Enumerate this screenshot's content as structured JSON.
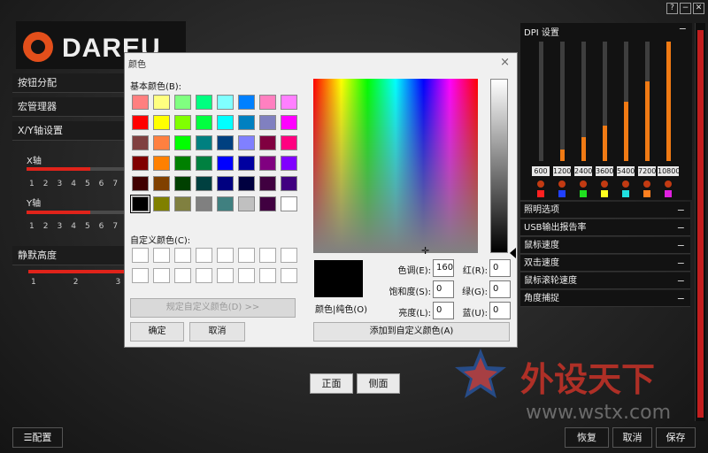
{
  "window_controls": [
    "?",
    "−",
    "✕"
  ],
  "logo": {
    "text": "DAREU"
  },
  "left_panel": {
    "sections": [
      "按钮分配",
      "宏管理器",
      "X/Y轴设置"
    ],
    "x_axis_label": "X轴",
    "y_axis_label": "Y轴",
    "x_value_fraction": 0.63,
    "y_value_fraction": 0.63,
    "axis_ticks": [
      "1",
      "2",
      "3",
      "4",
      "5",
      "6",
      "7"
    ],
    "silent_height_label": "静默高度",
    "silent_ticks": [
      "1",
      "2",
      "3"
    ],
    "silent_value_fraction": 1.0
  },
  "color_dialog": {
    "title": "颜色",
    "close": "×",
    "basic_colors_label": "基本颜色(B):",
    "basic_colors": [
      "#ff8080",
      "#ffff80",
      "#80ff80",
      "#00ff80",
      "#80ffff",
      "#0080ff",
      "#ff80c0",
      "#ff80ff",
      "#ff0000",
      "#ffff00",
      "#80ff00",
      "#00ff40",
      "#00ffff",
      "#0080c0",
      "#8080c0",
      "#ff00ff",
      "#804040",
      "#ff8040",
      "#00ff00",
      "#008080",
      "#004080",
      "#8080ff",
      "#800040",
      "#ff0080",
      "#800000",
      "#ff8000",
      "#008000",
      "#008040",
      "#0000ff",
      "#0000a0",
      "#800080",
      "#8000ff",
      "#400000",
      "#804000",
      "#004000",
      "#004040",
      "#000080",
      "#000040",
      "#400040",
      "#400080",
      "#000000",
      "#808000",
      "#808040",
      "#808080",
      "#408080",
      "#c0c0c0",
      "#400040",
      "#ffffff"
    ],
    "custom_colors_label": "自定义颜色(C):",
    "define_custom_button": "规定自定义颜色(D) >>",
    "ok_button": "确定",
    "cancel_button": "取消",
    "color_solid_label": "颜色|纯色(O)",
    "hue_label": "色调(E):",
    "hue_value": "160",
    "sat_label": "饱和度(S):",
    "sat_value": "0",
    "lum_label": "亮度(L):",
    "lum_value": "0",
    "red_label": "红(R):",
    "red_value": "0",
    "green_label": "绿(G):",
    "green_value": "0",
    "blue_label": "蓝(U):",
    "blue_value": "0",
    "add_custom_button": "添加到自定义颜色(A)"
  },
  "dpi_panel": {
    "title": "DPI 设置",
    "collapse": "−",
    "levels": [
      {
        "value": "600",
        "fraction": 0.0,
        "color": "#ff2020"
      },
      {
        "value": "1200",
        "fraction": 0.1,
        "color": "#2040ff"
      },
      {
        "value": "2400",
        "fraction": 0.2,
        "color": "#20e020"
      },
      {
        "value": "3600",
        "fraction": 0.3,
        "color": "#ffff20"
      },
      {
        "value": "5400",
        "fraction": 0.5,
        "color": "#20e0e0"
      },
      {
        "value": "7200",
        "fraction": 0.67,
        "color": "#ff8020"
      },
      {
        "value": "10800",
        "fraction": 1.0,
        "color": "#e020e0"
      }
    ]
  },
  "right_sections": [
    {
      "label": "照明选项",
      "icon": "−"
    },
    {
      "label": "USB输出报告率",
      "icon": "−"
    },
    {
      "label": "鼠标速度",
      "icon": "−"
    },
    {
      "label": "双击速度",
      "icon": "−"
    },
    {
      "label": "鼠标滚轮速度",
      "icon": "−"
    },
    {
      "label": "角度捕捉",
      "icon": "−"
    }
  ],
  "view_buttons": {
    "front": "正面",
    "side": "侧面"
  },
  "bottom_bar": {
    "config_button": "☰配置",
    "restore_button": "恢复",
    "cancel_button": "取消",
    "save_button": "保存"
  },
  "watermark": {
    "title": "外设天下",
    "url": "www.wstx.com"
  }
}
